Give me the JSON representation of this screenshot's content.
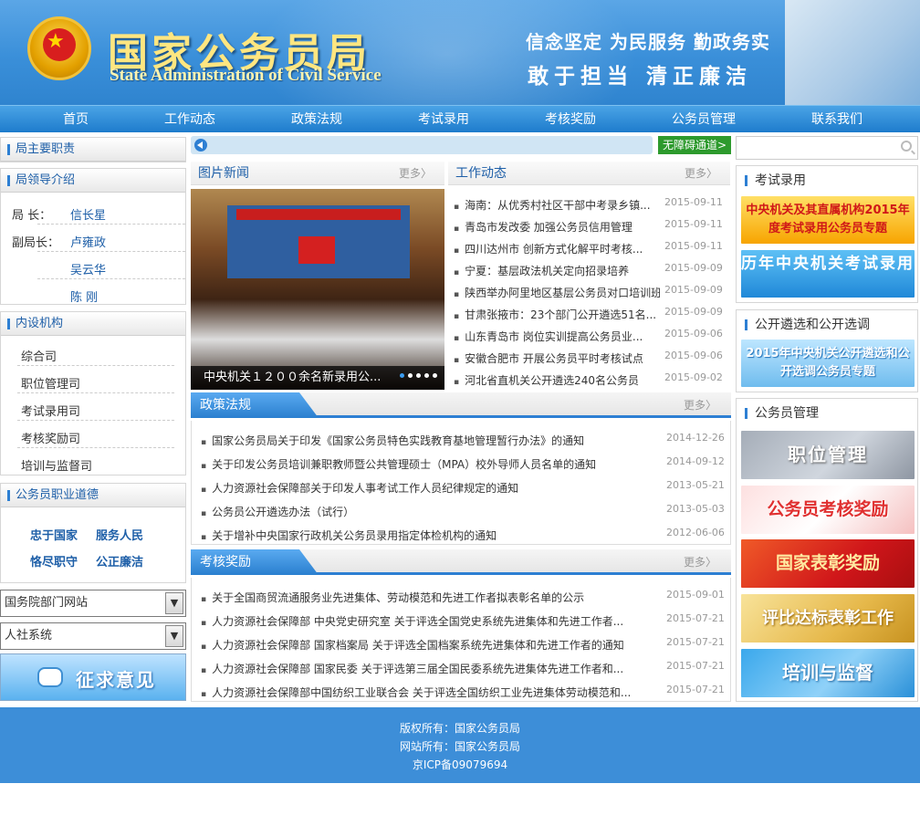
{
  "header": {
    "title_cn": "国家公务员局",
    "title_en": "State Administration of Civil Service",
    "slogan_line1": "信念坚定  为民服务  勤政务实",
    "slogan_line2": "敢于担当  清正廉洁"
  },
  "nav": [
    "首页",
    "工作动态",
    "政策法规",
    "考试录用",
    "考核奖励",
    "公务员管理",
    "联系我们"
  ],
  "left": {
    "duties_title": "局主要职责",
    "leaders_title": "局领导介绍",
    "leaders": [
      {
        "role": "局  长：",
        "name": "信长星"
      },
      {
        "role": "副局长：",
        "name": "卢雍政"
      },
      {
        "role": "",
        "name": "吴云华"
      },
      {
        "role": "",
        "name": "陈  刚"
      }
    ],
    "depts_title": "内设机构",
    "depts": [
      "综合司",
      "职位管理司",
      "考试录用司",
      "考核奖励司",
      "培训与监督司"
    ],
    "ethics_title": "公务员职业道德",
    "ethics": [
      "忠于国家",
      "服务人民",
      "恪尽职守",
      "公正廉洁"
    ],
    "select1": "国务院部门网站",
    "select2": "人社系统",
    "feedback": "征求意见"
  },
  "middle": {
    "accessibility": "无障碍通道>",
    "photo_news_title": "图片新闻",
    "more": "更多〉",
    "photo_caption": "中央机关１２００余名新录用公...",
    "work_title": "工作动态",
    "work_news": [
      {
        "title": "海南：从优秀村社区干部中考录乡镇...",
        "date": "2015-09-11"
      },
      {
        "title": "青岛市发改委 加强公务员信用管理",
        "date": "2015-09-11"
      },
      {
        "title": "四川达州市 创新方式化解平时考核...",
        "date": "2015-09-11"
      },
      {
        "title": "宁夏：基层政法机关定向招录培养",
        "date": "2015-09-09"
      },
      {
        "title": "陕西举办阿里地区基层公务员对口培训班",
        "date": "2015-09-09"
      },
      {
        "title": "甘肃张掖市：23个部门公开遴选51名...",
        "date": "2015-09-09"
      },
      {
        "title": "山东青岛市 岗位实训提高公务员业...",
        "date": "2015-09-06"
      },
      {
        "title": "安徽合肥市 开展公务员平时考核试点",
        "date": "2015-09-06"
      },
      {
        "title": "河北省直机关公开遴选240名公务员",
        "date": "2015-09-02"
      }
    ],
    "policy_title": "政策法规",
    "policy": [
      {
        "title": "国家公务员局关于印发《国家公务员特色实践教育基地管理暂行办法》的通知",
        "date": "2014-12-26"
      },
      {
        "title": "关于印发公务员培训兼职教师暨公共管理硕士（MPA）校外导师人员名单的通知",
        "date": "2014-09-12"
      },
      {
        "title": "人力资源社会保障部关于印发人事考试工作人员纪律规定的通知",
        "date": "2013-05-21"
      },
      {
        "title": "公务员公开遴选办法（试行）",
        "date": "2013-05-03"
      },
      {
        "title": "关于增补中央国家行政机关公务员录用指定体检机构的通知",
        "date": "2012-06-06"
      }
    ],
    "reward_title": "考核奖励",
    "reward": [
      {
        "title": "关于全国商贸流通服务业先进集体、劳动模范和先进工作者拟表彰名单的公示",
        "date": "2015-09-01"
      },
      {
        "title": "人力资源社会保障部 中央党史研究室 关于评选全国党史系统先进集体和先进工作者...",
        "date": "2015-07-21"
      },
      {
        "title": "人力资源社会保障部 国家档案局 关于评选全国档案系统先进集体和先进工作者的通知",
        "date": "2015-07-21"
      },
      {
        "title": "人力资源社会保障部 国家民委 关于评选第三届全国民委系统先进集体先进工作者和...",
        "date": "2015-07-21"
      },
      {
        "title": "人力资源社会保障部中国纺织工业联合会 关于评选全国纺织工业先进集体劳动模范和...",
        "date": "2015-07-21"
      }
    ]
  },
  "right": {
    "exam_title": "考试录用",
    "exam_banners": [
      "中央机关及其直属机构2015年度考试录用公务员专题",
      "历年中央机关考试录用"
    ],
    "select_title": "公开遴选和公开选调",
    "select_banner": "2015年中央机关公开遴选和公开选调公务员专题",
    "mgmt_title": "公务员管理",
    "mgmt_banners": [
      "职位管理",
      "公务员考核奖励",
      "国家表彰奖励",
      "评比达标表彰工作",
      "培训与监督"
    ]
  },
  "footer": {
    "line1": "版权所有：国家公务员局",
    "line2": "网站所有：国家公务员局",
    "line3": "京ICP备09079694"
  }
}
